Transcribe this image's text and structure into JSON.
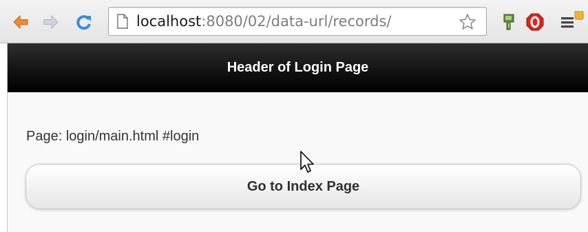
{
  "browser": {
    "nav": {
      "back_icon": "arrow-left-icon",
      "forward_icon": "arrow-right-icon",
      "reload_icon": "reload-icon"
    },
    "address_bar": {
      "host": "localhost",
      "path": ":8080/02/data-url/records/",
      "page_icon": "page-icon",
      "bookmark_icon": "star-icon"
    },
    "extensions": [
      {
        "name": "green-extension-icon"
      },
      {
        "name": "red-stop-extension-icon"
      }
    ],
    "menu_icon": "hamburger-menu-icon"
  },
  "page": {
    "header_title": "Header of Login Page",
    "info_text": "Page: login/main.html #login",
    "button_label": "Go to Index Page"
  },
  "colors": {
    "header_bg": "#000000",
    "header_text": "#ffffff",
    "page_bg": "#f9f9f9",
    "back_arrow": "#f08a36",
    "reload": "#3a8dd6"
  }
}
